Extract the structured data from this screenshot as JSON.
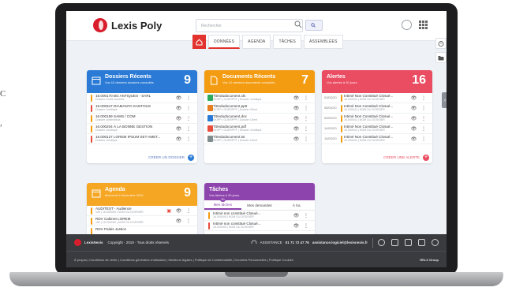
{
  "stray_text": {
    "line1": "C",
    "line2": ","
  },
  "app": {
    "name": "Lexis Poly",
    "brand_color": "#d81d2c"
  },
  "search": {
    "placeholder": "Rechercher",
    "filter_label": ""
  },
  "nav": {
    "tabs": [
      {
        "label": "DONNÉES",
        "active": true
      },
      {
        "label": "AGENDA",
        "active": false
      },
      {
        "label": "TÂCHES",
        "active": false
      },
      {
        "label": "ASSEMBLÉES",
        "active": false
      }
    ]
  },
  "dossiers": {
    "title": "Dossiers Récents",
    "subtitle": "Vos 10 derniers dossiers consultés",
    "count": "9",
    "color": "#2b7bd6",
    "rows": [
      {
        "ref": "16.000170",
        "name": "BG ANTIQUES - SARL",
        "detail": "Dossier Droits sociétés",
        "bar": "#f39c12"
      },
      {
        "ref": "19.000347",
        "name": "DIAMANTA GANTOUS",
        "detail": "Dossier Juridique",
        "bar": "#e74c3c"
      },
      {
        "ref": "16.000159",
        "name": "SAMS / COM",
        "detail": "Dossier contentieux",
        "bar": "#f39c12"
      },
      {
        "ref": "16.000204",
        "name": "À LA BONNE GESTION",
        "detail": "Dossier Juridique",
        "bar": "#f39c12"
      },
      {
        "ref": "16.000127",
        "name": "LOREM IPSUM SET AMET...",
        "detail": "Dossier Juridique",
        "bar": "#e74c3c"
      }
    ],
    "footer": "CRÉER UN DOSSIER"
  },
  "documents": {
    "title": "Documents Récents",
    "subtitle": "Vos 10 derniers documents consultés",
    "count": "7",
    "color": "#f39c12",
    "rows": [
      {
        "name": "Titredudocument.xls",
        "detail": "SKIPP | GUERPPF | Dossier Juridique",
        "icon": "#2eaa5c"
      },
      {
        "name": "Titredudocument.pptt",
        "detail": "SKIPP | GUERPPF | Dossier Client",
        "icon": "#e67e22"
      },
      {
        "name": "Titredudocument.doc",
        "detail": "SKIPP | GUERPPF | Dossier Client",
        "icon": "#2b7bd6"
      },
      {
        "name": "Titredudocument.pdf",
        "detail": "SKIPP | GUERPPF | Dossier Juridique",
        "icon": "#e74c3c"
      },
      {
        "name": "Titredudocument.txt",
        "detail": "SKIPP | GUERPPF | Dossier Client",
        "icon": "#7f8c8d"
      }
    ]
  },
  "alertes": {
    "title": "Alertes",
    "subtitle": "Vos alertes à 30 jours",
    "count": "16",
    "color": "#ea4c62",
    "rows": [
      {
        "date": "03/02/20",
        "name": "Intimé Non Constitué Closué...",
        "detail": "16.000041 | NOM DU DOSSIER"
      },
      {
        "date": "08/02/20",
        "name": "Intimé Non Constitué Closué...",
        "detail": "16.000041 | NOM DU DOSSIER"
      },
      {
        "date": "09/02/20",
        "name": "Intimé Non Constitué Closué...",
        "detail": "16.000041 | NOM DU DOSSIER"
      },
      {
        "date": "10/02/20",
        "name": "Intimé Non Constitué Closué...",
        "detail": "16.000041 | NOM DU DOSSIER"
      },
      {
        "date": "15/02/20",
        "name": "Intimé Non Constitué Closué...",
        "detail": "16.000041 | NOM DU DOSSIER"
      }
    ],
    "footer": "CRÉER UNE ALERTE"
  },
  "agenda": {
    "title": "Agenda",
    "subtitle": "Mercredi 4 Décembre 2019",
    "count": "9",
    "color": "#f5a623",
    "rows": [
      {
        "name": "AUDITEST - Audience",
        "detail": "14h | 16.000005 | NOM DU DOSSIER"
      },
      {
        "name": "RDV Cabinet LOREM",
        "detail": "15h | 16.000005 | NOM DU DOSSIER"
      },
      {
        "name": "RDV Palais Justice",
        "detail": ""
      }
    ]
  },
  "taches": {
    "title": "Tâches",
    "subtitle": "Vos tâches à 30 jours",
    "color": "#8e44ad",
    "tabs": [
      {
        "label": "Mes tâches",
        "badge": "10"
      },
      {
        "label": "Mes demandes",
        "badge": ""
      },
      {
        "label": "À tra",
        "badge": ""
      }
    ],
    "rows": [
      {
        "name": "Intimé non constitué Closué...",
        "detail": "16.000005 | NOM DU DOSSIER"
      },
      {
        "name": "Intimé non constitué Closué...",
        "detail": "16.000005 | NOM DU DOSSIER"
      }
    ]
  },
  "footer": {
    "brand": "LexisNexis",
    "copyright": "Copyright · 2019 · Tous droits réservés",
    "assistance_label": "ASSISTANCE",
    "phone": "01 71 72 47 76",
    "email_label": "assistance.logiciel@lexisnexis.fr",
    "links": "À propos | Conditions de vente | Conditions générales d'utilisation | Mentions légales | Politique de Confidentialité | Données Personnelles | Politique Cookies",
    "relx": "RELX Group"
  }
}
